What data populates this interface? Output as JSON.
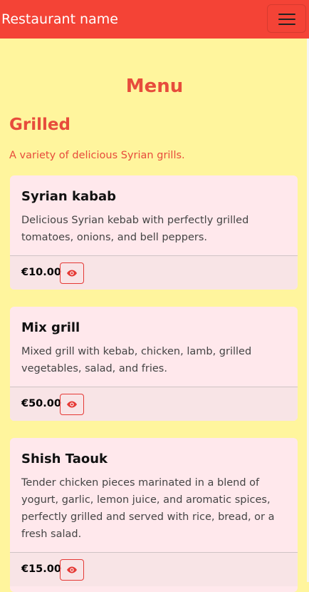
{
  "navbar": {
    "brand": "Restaurant name",
    "toggler_icon": "hamburger-menu-icon"
  },
  "page": {
    "title": "Menu"
  },
  "section": {
    "title": "Grilled",
    "description": "A variety of delicious Syrian grills."
  },
  "items": [
    {
      "name": "Syrian kabab",
      "description": "Delicious Syrian kebab with perfectly grilled tomatoes, onions, and bell peppers.",
      "price": "€10.00",
      "view_icon": "eye-icon"
    },
    {
      "name": "Mix grill",
      "description": "Mixed grill with kebab, chicken, lamb, grilled vegetables, salad, and fries.",
      "price": "€50.00",
      "view_icon": "eye-icon"
    },
    {
      "name": "Shish Taouk",
      "description": "Tender chicken pieces marinated in a blend of yogurt, garlic, lemon juice, and aromatic spices, perfectly grilled and served with rice, bread, or a fresh salad.",
      "price": "€15.00",
      "view_icon": "eye-icon"
    }
  ],
  "colors": {
    "navbar": "#f44336",
    "background": "#fff59d",
    "accent": "#e74c3c",
    "card": "#ffe8ec",
    "card_footer": "#f8e4e6"
  }
}
